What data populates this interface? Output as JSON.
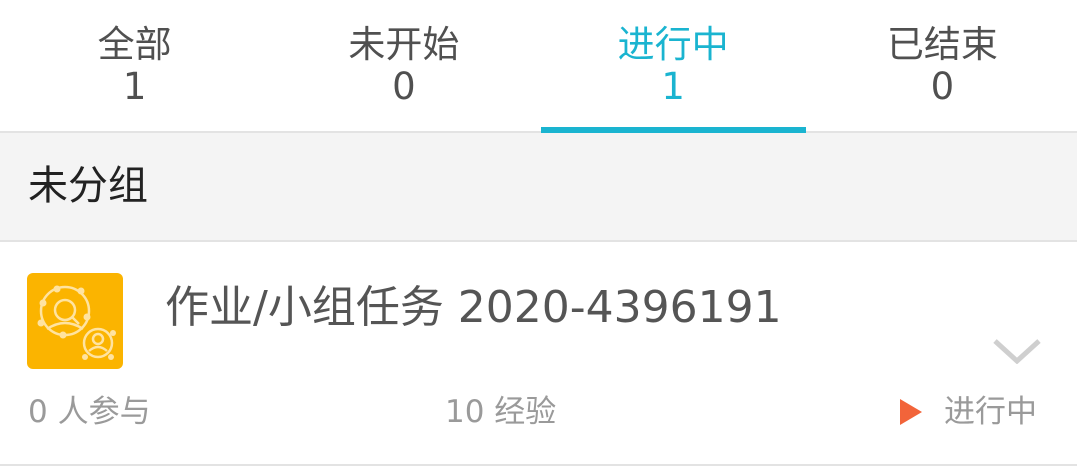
{
  "tabs": [
    {
      "label": "全部",
      "count": "1",
      "active": false
    },
    {
      "label": "未开始",
      "count": "0",
      "active": false
    },
    {
      "label": "进行中",
      "count": "1",
      "active": true
    },
    {
      "label": "已结束",
      "count": "0",
      "active": false
    }
  ],
  "colors": {
    "accent": "#1ab4d0",
    "icon_bg": "#fbb400",
    "status_play": "#f2643a"
  },
  "group": {
    "title": "未分组"
  },
  "task": {
    "icon": "group-task-icon",
    "title": "作业/小组任务 2020-4396191",
    "participants": "0 人参与",
    "experience": "10 经验",
    "status_icon": "play-icon",
    "status": "进行中",
    "expand_icon": "chevron-down-icon"
  }
}
